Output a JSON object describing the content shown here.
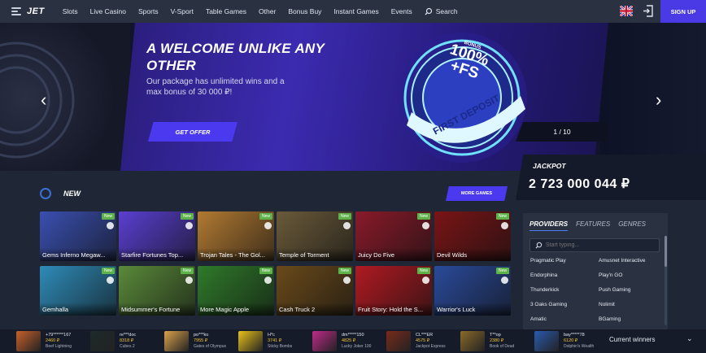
{
  "header": {
    "logo": "JET",
    "nav": [
      "Slots",
      "Live Casino",
      "Sports",
      "V-Sport",
      "Table Games",
      "Other",
      "Bonus Buy",
      "Instant Games",
      "Events"
    ],
    "search_label": "Search",
    "signup_label": "SIGN UP"
  },
  "hero": {
    "title": "A WELCOME UNLIKE ANY OTHER",
    "subtitle": "Our package has unlimited wins and a max bonus of 30 000 ₽!",
    "cta": "GET OFFER",
    "pager": "1 / 10",
    "badge_small": "BONUS",
    "badge_big1": "100%",
    "badge_big2": "+FS",
    "badge_ring": "FIRST DEPOSIT"
  },
  "section": {
    "title": "NEW",
    "more": "MORE GAMES"
  },
  "games": [
    {
      "name": "Gems Inferno Megaw...",
      "tag": "New",
      "color": "#3a4fb0"
    },
    {
      "name": "Starfire Fortunes Top...",
      "tag": "New",
      "color": "#5a3fd0"
    },
    {
      "name": "Trojan Tales - The Gol...",
      "tag": "New",
      "color": "#b27a32"
    },
    {
      "name": "Temple of Torment",
      "tag": "New",
      "color": "#6a5a3a"
    },
    {
      "name": "Juicy Do Five",
      "tag": "New",
      "color": "#8a1a2a"
    },
    {
      "name": "Devil Wilds",
      "tag": "New",
      "color": "#7a1416"
    },
    {
      "name": "Gemhalla",
      "tag": "New",
      "color": "#2e8bb8"
    },
    {
      "name": "Midsummer's Fortune",
      "tag": "New",
      "color": "#5a8a3a"
    },
    {
      "name": "More Magic Apple",
      "tag": "New",
      "color": "#2f7a2a"
    },
    {
      "name": "Cash Truck 2",
      "tag": "New",
      "color": "#6a4a1a"
    },
    {
      "name": "Fruit Story: Hold the S...",
      "tag": "New",
      "color": "#b01a22"
    },
    {
      "name": "Warrior's Luck",
      "tag": "New",
      "color": "#2a4a9a"
    }
  ],
  "jackpot": {
    "label": "JACKPOT",
    "value": "2 723 000 044 ₽"
  },
  "providers": {
    "tabs": [
      "PROVIDERS",
      "FEATURES",
      "GENRES"
    ],
    "search_placeholder": "Start typing...",
    "left": [
      "Pragmatic Play",
      "Endorphina",
      "Thunderkick",
      "3 Oaks Gaming",
      "Amatic"
    ],
    "right": [
      "Amusnet Interactive",
      "Play'n GO",
      "Push Gaming",
      "Nolimit",
      "BGaming"
    ]
  },
  "winners": {
    "label": "Current winners",
    "items": [
      {
        "user": "+79******167",
        "amount": "2460 ₽",
        "game": "Beef Lightning",
        "color": "#c8602a"
      },
      {
        "user": "re***doc",
        "amount": "8318 ₽",
        "game": "Cubes 2",
        "color": "#1e2a2a"
      },
      {
        "user": "po***ko",
        "amount": "7955 ₽",
        "game": "Gates of Olympus",
        "color": "#d8a24a"
      },
      {
        "user": "H*c",
        "amount": "3741 ₽",
        "game": "Sticky Bombs",
        "color": "#e8c21a"
      },
      {
        "user": "dm*****150",
        "amount": "4825 ₽",
        "game": "Lucky Joker 100",
        "color": "#c02a8a"
      },
      {
        "user": "CL***ER",
        "amount": "4575 ₽",
        "game": "Jackpot Express",
        "color": "#7a2a1a"
      },
      {
        "user": "T**op",
        "amount": "2380 ₽",
        "game": "Book of Dead",
        "color": "#8a6a2a"
      },
      {
        "user": "bay*****78",
        "amount": "6120 ₽",
        "game": "Dolphin's Wealth",
        "color": "#2a5ab0"
      }
    ]
  }
}
